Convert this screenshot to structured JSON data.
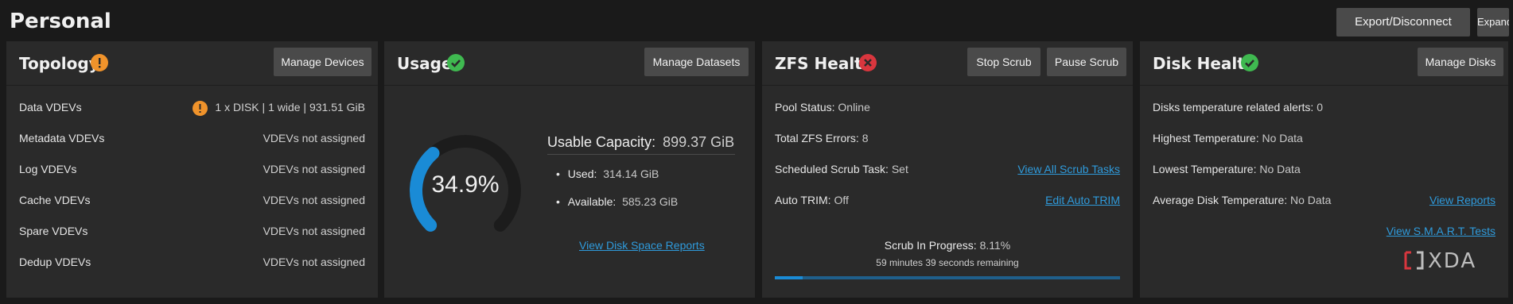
{
  "page": {
    "title": "Personal"
  },
  "header_buttons": {
    "export": "Export/Disconnect",
    "expand": "Expand"
  },
  "topology": {
    "title": "Topology",
    "button": "Manage Devices",
    "rows": [
      {
        "label": "Data VDEVs",
        "value": "1 x DISK | 1 wide | 931.51 GiB"
      },
      {
        "label": "Metadata VDEVs",
        "value": "VDEVs not assigned"
      },
      {
        "label": "Log VDEVs",
        "value": "VDEVs not assigned"
      },
      {
        "label": "Cache VDEVs",
        "value": "VDEVs not assigned"
      },
      {
        "label": "Spare VDEVs",
        "value": "VDEVs not assigned"
      },
      {
        "label": "Dedup VDEVs",
        "value": "VDEVs not assigned"
      }
    ]
  },
  "usage": {
    "title": "Usage",
    "button": "Manage Datasets",
    "gauge_text": "34.9%",
    "gauge_fraction": 0.349,
    "capacity_label": "Usable Capacity:",
    "capacity_value": "899.37 GiB",
    "used_label": "Used:",
    "used_value": "314.14 GiB",
    "available_label": "Available:",
    "available_value": "585.23 GiB",
    "reports_link": "View Disk Space Reports"
  },
  "zfs": {
    "title": "ZFS Health",
    "stop_button": "Stop Scrub",
    "pause_button": "Pause Scrub",
    "pool_status_label": "Pool Status:",
    "pool_status_value": "Online",
    "errors_label": "Total ZFS Errors:",
    "errors_value": "8",
    "scrub_task_label": "Scheduled Scrub Task:",
    "scrub_task_value": "Set",
    "scrub_tasks_link": "View All Scrub Tasks",
    "trim_label": "Auto TRIM:",
    "trim_value": "Off",
    "trim_link": "Edit Auto TRIM",
    "progress_label": "Scrub In Progress:",
    "progress_value": "8.11%",
    "progress_fraction": 0.0811,
    "remaining": "59 minutes 39 seconds remaining"
  },
  "disk": {
    "title": "Disk Health",
    "button": "Manage Disks",
    "alerts_label": "Disks temperature related alerts:",
    "alerts_value": "0",
    "highest_label": "Highest Temperature:",
    "highest_value": "No Data",
    "lowest_label": "Lowest Temperature:",
    "lowest_value": "No Data",
    "average_label": "Average Disk Temperature:",
    "average_value": "No Data",
    "reports_link": "View Reports",
    "smart_link": "View S.M.A.R.T. Tests"
  },
  "watermark": {
    "text": "XDA"
  },
  "colors": {
    "warning": "#f0932b",
    "ok": "#3fb950",
    "error": "#d9363e",
    "accent": "#1a8bd6",
    "link": "#2f9bdc"
  },
  "icons": {
    "topology_status": "warning-icon",
    "usage_status": "check-circle-icon",
    "zfs_status": "error-icon",
    "disk_status": "check-circle-icon"
  }
}
